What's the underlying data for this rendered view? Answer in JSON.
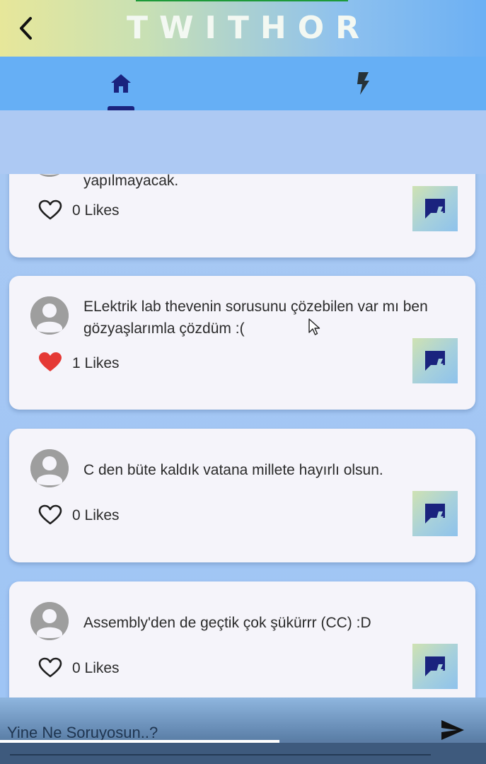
{
  "app": {
    "title": "TWITHOR"
  },
  "tabs": [
    {
      "name": "home",
      "icon": "home-icon",
      "active": true
    },
    {
      "name": "flash",
      "icon": "flash-icon",
      "active": false
    }
  ],
  "posts": [
    {
      "text": "yapılmayacak.",
      "liked": false,
      "likes_label": "0 Likes",
      "partial": true
    },
    {
      "text": "ELektrik lab thevenin sorusunu çözebilen var mı ben gözyaşlarımla çözdüm :(",
      "liked": true,
      "likes_label": "1 Likes"
    },
    {
      "text": "C den büte kaldık vatana millete hayırlı olsun.",
      "liked": false,
      "likes_label": "0 Likes"
    },
    {
      "text": "Assembly'den de geçtik çok şükürrr (CC) :D",
      "liked": false,
      "likes_label": "0 Likes"
    }
  ],
  "composer": {
    "placeholder": "Yine Ne Soruyosun..?"
  },
  "colors": {
    "accent": "#1a237e",
    "liked_heart": "#e53935",
    "card_bg": "#f5f4fa"
  }
}
